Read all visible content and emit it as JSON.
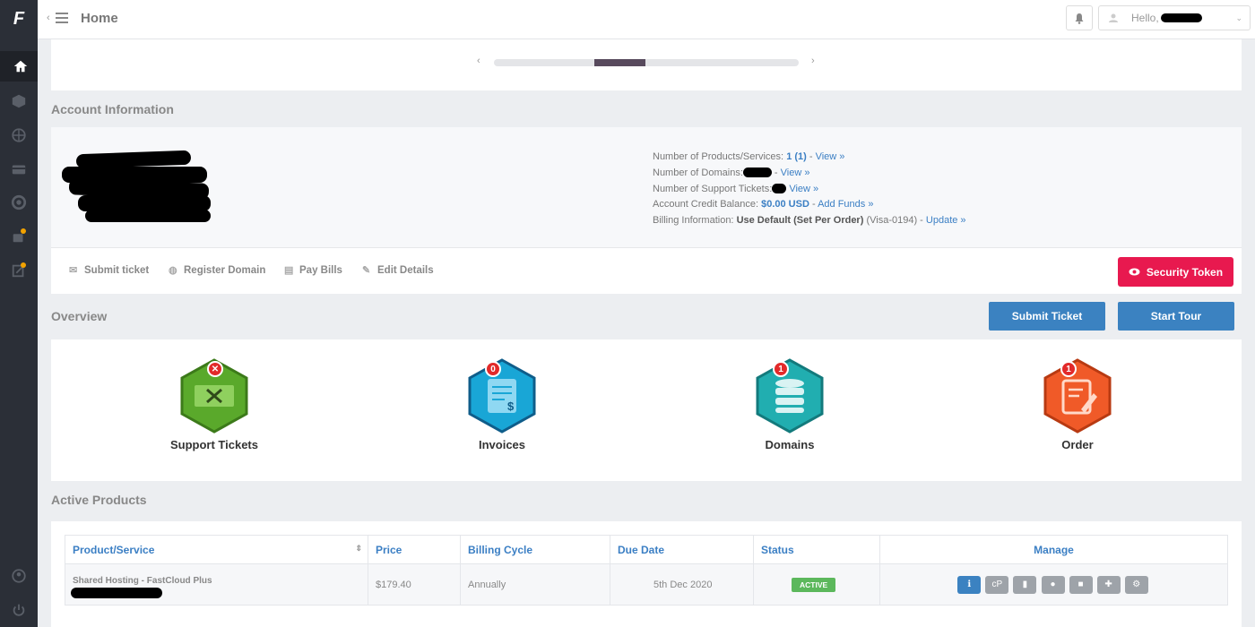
{
  "header": {
    "title": "Home",
    "greeting": "Hello,"
  },
  "sidebar": {
    "logo": "F",
    "items": [
      "home-icon",
      "box-icon",
      "globe-icon",
      "billing-icon",
      "support-icon",
      "addon-icon",
      "edit-icon"
    ],
    "bottom": [
      "user-icon",
      "logout-icon"
    ]
  },
  "account": {
    "section_title": "Account Information",
    "products_label": "Number of Products/Services:",
    "products_value": "1 (1)",
    "view_link": "View »",
    "domains_label": "Number of Domains:",
    "tickets_label": "Number of Support Tickets:",
    "credit_label": "Account Credit Balance:",
    "credit_value": "$0.00 USD",
    "add_funds": "Add Funds »",
    "billing_label": "Billing Information:",
    "billing_value": "Use Default (Set Per Order)",
    "billing_card": "(Visa-0194)",
    "update_link": "Update »",
    "actions": {
      "submit_ticket": "Submit ticket",
      "register_domain": "Register Domain",
      "pay_bills": "Pay Bills",
      "edit_details": "Edit Details",
      "security_token": "Security Token"
    }
  },
  "overview": {
    "section_title": "Overview",
    "submit_ticket": "Submit Ticket",
    "start_tour": "Start Tour",
    "items": [
      {
        "label": "Support Tickets",
        "badge": ""
      },
      {
        "label": "Invoices",
        "badge": "0"
      },
      {
        "label": "Domains",
        "badge": "1"
      },
      {
        "label": "Order",
        "badge": "1"
      }
    ]
  },
  "products": {
    "section_title": "Active Products",
    "headers": [
      "Product/Service",
      "Price",
      "Billing Cycle",
      "Due Date",
      "Status",
      "Manage"
    ],
    "rows": [
      {
        "name": "Shared Hosting - FastCloud Plus",
        "price": "$179.40",
        "cycle": "Annually",
        "due": "5th Dec 2020",
        "status": "ACTIVE"
      }
    ]
  },
  "colors": {
    "sidebar": "#2b2f37",
    "accent_blue": "#3b82c1",
    "security_red": "#e8194f",
    "status_green": "#5cb85c"
  }
}
